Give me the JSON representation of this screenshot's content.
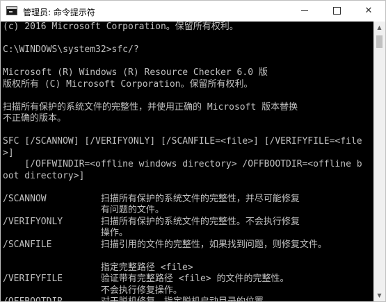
{
  "window": {
    "title": "管理员: 命令提示符",
    "controls": {
      "minimize": "",
      "maximize": "",
      "close": "✕"
    }
  },
  "console": {
    "lines": [
      "(c) 2016 Microsoft Corporation。保留所有权利。",
      "",
      "C:\\WINDOWS\\system32>sfc/?",
      "",
      "Microsoft (R) Windows (R) Resource Checker 6.0 版",
      "版权所有 (C) Microsoft Corporation。保留所有权利。",
      "",
      "扫描所有保护的系统文件的完整性，并使用正确的 Microsoft 版本替换",
      "不正确的版本。",
      "",
      "SFC [/SCANNOW] [/VERIFYONLY] [/SCANFILE=<file>] [/VERIFYFILE=<file",
      ">]",
      "    [/OFFWINDIR=<offline windows directory> /OFFBOOTDIR=<offline b",
      "oot directory>]",
      "",
      "/SCANNOW          扫描所有保护的系统文件的完整性，并尽可能修复",
      "                  有问题的文件。",
      "/VERIFYONLY       扫描所有保护的系统文件的完整性。不会执行修复",
      "                  操作。",
      "/SCANFILE         扫描引用的文件的完整性，如果找到问题，则修复文件。",
      "",
      "                  指定完整路径 <file>",
      "/VERIFYFILE       验证带有完整路径 <file> 的文件的完整性。",
      "                  不会执行修复操作。",
      "/OFFBOOTDIR       对于脱机修复，指定脱机启动目录的位置"
    ]
  },
  "scrollbar": {
    "up_arrow": "▲",
    "down_arrow": "▼"
  },
  "colors": {
    "console_bg": "#000000",
    "console_fg": "#c0c0c0",
    "titlebar_bg": "#ffffff"
  }
}
